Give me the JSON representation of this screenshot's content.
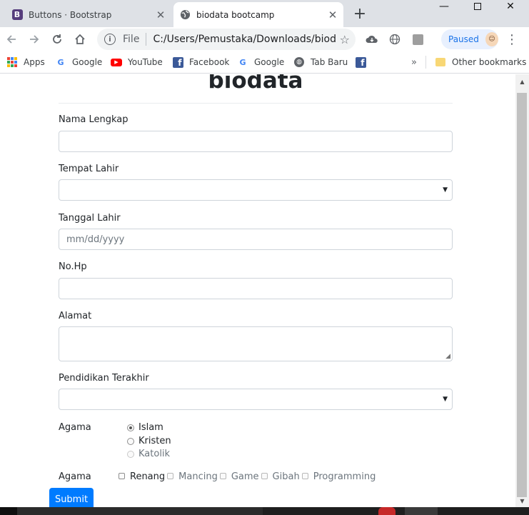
{
  "browser": {
    "tabs": [
      {
        "title": "Buttons · Bootstrap",
        "icon": "bootstrap-icon",
        "active": false
      },
      {
        "title": "biodata bootcamp",
        "icon": "globe-icon",
        "active": true
      }
    ],
    "address": {
      "scheme_label": "File",
      "url": "C:/Users/Pemustaka/Downloads/biodat..."
    },
    "profile_status": "Paused",
    "bookmarks": [
      {
        "label": "Apps",
        "icon": "apps-grid-icon"
      },
      {
        "label": "Google",
        "icon": "google-icon"
      },
      {
        "label": "YouTube",
        "icon": "youtube-icon"
      },
      {
        "label": "Facebook",
        "icon": "facebook-icon"
      },
      {
        "label": "Google",
        "icon": "google-icon"
      },
      {
        "label": "Tab Baru",
        "icon": "globe-icon"
      }
    ],
    "other_bookmarks": "Other bookmarks"
  },
  "page": {
    "title": "biodata",
    "fields": {
      "nama": {
        "label": "Nama Lengkap",
        "value": ""
      },
      "tempat": {
        "label": "Tempat Lahir",
        "value": ""
      },
      "tanggal": {
        "label": "Tanggal Lahir",
        "placeholder": "mm/dd/yyyy"
      },
      "hp": {
        "label": "No.Hp",
        "value": ""
      },
      "alamat": {
        "label": "Alamat",
        "value": ""
      },
      "pendidikan": {
        "label": "Pendidikan Terakhir",
        "value": ""
      }
    },
    "agama_radio": {
      "label": "Agama",
      "options": [
        "Islam",
        "Kristen",
        "Katolik"
      ],
      "selected": "Islam"
    },
    "agama_checkbox": {
      "label": "Agama",
      "options": [
        "Renang",
        "Mancing",
        "Game",
        "Gibah",
        "Programming"
      ]
    },
    "submit_label": "Submit"
  },
  "colors": {
    "primary": "#007bff",
    "tabstrip": "#dee1e6",
    "bootstrap_purple": "#563d7c"
  }
}
